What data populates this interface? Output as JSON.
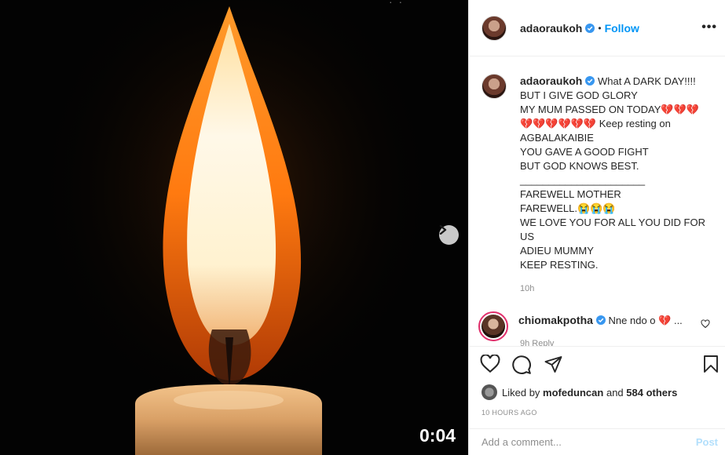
{
  "post": {
    "username": "adaoraukoh",
    "follow_label": "Follow",
    "bullet": "•",
    "more_label": "•••",
    "video_time": "0:04",
    "caption_lines": [
      "What A DARK DAY!!!!",
      "BUT I GIVE GOD GLORY",
      "MY MUM PASSED ON TODAY💔💔💔",
      "💔💔💔💔💔💔 Keep resting on",
      "AGBALAKAIBIE",
      "YOU GAVE A GOOD FIGHT",
      "BUT GOD KNOWS BEST.",
      "",
      "______________________",
      "FAREWELL MOTHER",
      "FAREWELL.😭😭😭",
      "WE LOVE YOU FOR ALL YOU DID FOR",
      "US",
      "ADIEU MUMMY",
      "KEEP RESTING."
    ],
    "caption_time": "10h"
  },
  "comment": {
    "username": "chiomakpotha",
    "text": "Nne ndo o 💔",
    "ellipsis": "...",
    "meta": "9h   Reply"
  },
  "likes": {
    "prefix": "Liked by",
    "user": "mofeduncan",
    "middle": "and",
    "others": "584 others"
  },
  "time_ago": "10 HOURS AGO",
  "add_comment": {
    "placeholder": "Add a comment...",
    "post_label": "Post"
  },
  "colors": {
    "accent": "#0095f6",
    "verified": "#3897f0",
    "post_disabled": "#b2dffc"
  }
}
